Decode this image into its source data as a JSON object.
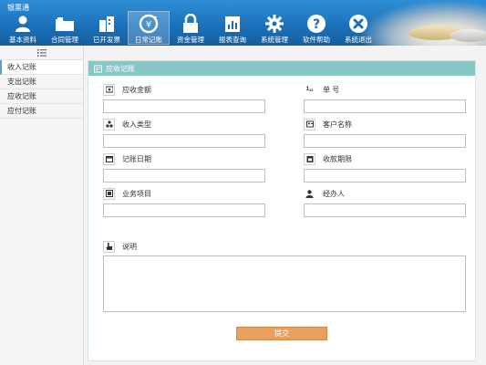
{
  "app": {
    "title": "银票通"
  },
  "nav": [
    {
      "label": "基本资料",
      "icon": "user-icon"
    },
    {
      "label": "合同管理",
      "icon": "contract-folder-icon"
    },
    {
      "label": "已开发票",
      "icon": "invoice-buildings-icon"
    },
    {
      "label": "日常记账",
      "icon": "accounting-cycle-icon",
      "active": true
    },
    {
      "label": "资金管理",
      "icon": "lock-icon"
    },
    {
      "label": "报表查询",
      "icon": "report-icon"
    },
    {
      "label": "系统管理",
      "icon": "gear-icon"
    },
    {
      "label": "软件帮助",
      "icon": "help-icon"
    },
    {
      "label": "系统退出",
      "icon": "exit-icon"
    }
  ],
  "sidebar": {
    "toggle_icon": "menu-icon",
    "items": [
      {
        "label": "收入记账",
        "active": true
      },
      {
        "label": "支出记账"
      },
      {
        "label": "应收记账"
      },
      {
        "label": "应付记账"
      }
    ]
  },
  "panel": {
    "title": "应收记账",
    "icon": "receivable-icon"
  },
  "form": {
    "amount": {
      "label": "应收金额",
      "icon": "money-icon",
      "value": ""
    },
    "doc_no": {
      "label": "单 号",
      "icon": "number-icon",
      "value": ""
    },
    "income_type": {
      "label": "收入类型",
      "icon": "category-icon",
      "value": ""
    },
    "customer": {
      "label": "客户名称",
      "icon": "customer-icon",
      "value": ""
    },
    "record_date": {
      "label": "记账日期",
      "icon": "calendar-icon",
      "value": ""
    },
    "due_date": {
      "label": "收款期限",
      "icon": "deadline-icon",
      "value": ""
    },
    "project": {
      "label": "业务项目",
      "icon": "project-icon",
      "value": ""
    },
    "handler": {
      "label": "经办人",
      "icon": "person-icon",
      "value": ""
    },
    "notes": {
      "label": "说明",
      "icon": "hand-pointer-icon",
      "value": ""
    },
    "submit_label": "提交"
  },
  "colors": {
    "topbar": "#1a6fb8",
    "panel_header": "#86c8c8",
    "submit": "#e8a060"
  }
}
